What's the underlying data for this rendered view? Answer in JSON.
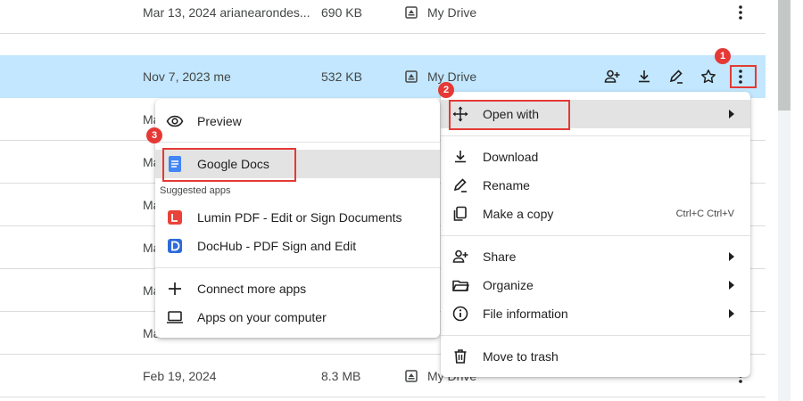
{
  "file_rows": [
    {
      "modified": "Mar 13, 2024 arianearondes...",
      "size": "690 KB",
      "location": "My Drive"
    },
    {
      "modified": "Nov 7, 2023 me",
      "size": "532 KB",
      "location": "My Drive"
    },
    {
      "modified": "Ma",
      "size": "",
      "location": ""
    },
    {
      "modified": "Ma",
      "size": "",
      "location": ""
    },
    {
      "modified": "Ma",
      "size": "",
      "location": ""
    },
    {
      "modified": "Ma",
      "size": "",
      "location": ""
    },
    {
      "modified": "Ma",
      "size": "",
      "location": ""
    },
    {
      "modified": "Ma",
      "size": "",
      "location": ""
    },
    {
      "modified": "Feb 19, 2024",
      "size": "8.3 MB",
      "location": "My Drive"
    }
  ],
  "row_action_icons": [
    "share-person-add-icon",
    "download-icon",
    "rename-pencil-icon",
    "star-icon",
    "more-vert-icon"
  ],
  "main_menu": {
    "open_with": "Open with",
    "download": "Download",
    "rename": "Rename",
    "make_copy": "Make a copy",
    "make_copy_shortcut": "Ctrl+C Ctrl+V",
    "share": "Share",
    "organize": "Organize",
    "file_information": "File information",
    "move_to_trash": "Move to trash"
  },
  "open_with_menu": {
    "preview": "Preview",
    "google_docs": "Google Docs",
    "suggested_header": "Suggested apps",
    "lumin": "Lumin PDF - Edit or Sign Documents",
    "dochub": "DocHub - PDF Sign and Edit",
    "connect_more": "Connect more apps",
    "apps_on_computer": "Apps on your computer"
  },
  "annotations": {
    "badge_1": "1",
    "badge_2": "2",
    "badge_3": "3"
  },
  "colors": {
    "selected_row": "#c2e7ff",
    "highlight": "#e3e3e3",
    "annotation_red": "#e53935",
    "docs_blue": "#4285f4",
    "lumin_red": "#e8433a",
    "dochub_blue": "#2e6bd9"
  }
}
